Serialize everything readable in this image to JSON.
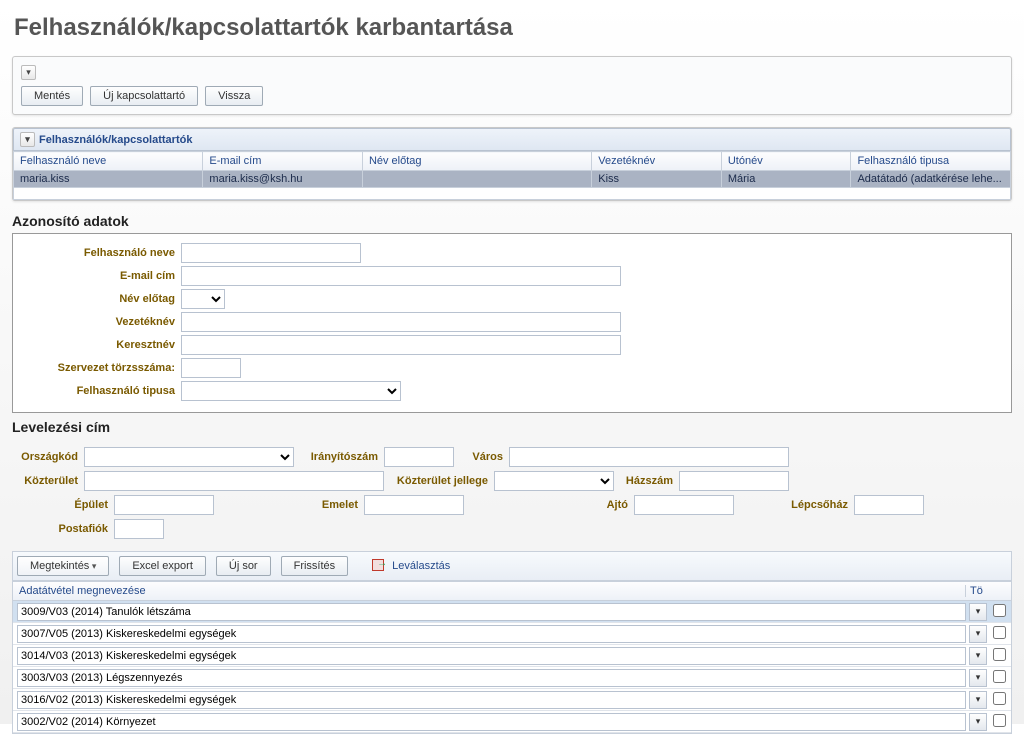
{
  "page_title": "Felhasználók/kapcsolattartók karbantartása",
  "top_panel": {
    "save_label": "Mentés",
    "new_contact_label": "Új kapcsolattartó",
    "back_label": "Vissza"
  },
  "users_panel": {
    "header": "Felhasználók/kapcsolattartók",
    "columns": {
      "username": "Felhasználó neve",
      "email": "E-mail cím",
      "prefix": "Név előtag",
      "lastname": "Vezetéknév",
      "firstname": "Utónév",
      "type": "Felhasználó tipusa"
    },
    "row": {
      "username": "maria.kiss",
      "email": "maria.kiss@ksh.hu",
      "prefix": "",
      "lastname": "Kiss",
      "firstname": "Mária",
      "type": "Adatátadó (adatkérése lehe..."
    }
  },
  "id_section": {
    "title": "Azonosító adatok",
    "labels": {
      "username": "Felhasználó neve",
      "email": "E-mail cím",
      "prefix": "Név előtag",
      "lastname": "Vezetéknév",
      "firstname": "Keresztnév",
      "orgid": "Szervezet törzsszáma:",
      "type": "Felhasználó tipusa"
    }
  },
  "mail_section": {
    "title": "Levelezési cím",
    "labels": {
      "country": "Országkód",
      "zip": "Irányítószám",
      "city": "Város",
      "street": "Közterület",
      "street_type": "Közterület jellege",
      "house_no": "Házszám",
      "building": "Épület",
      "floor": "Emelet",
      "door": "Ajtó",
      "stair": "Lépcsőház",
      "pobox": "Postafiók"
    }
  },
  "toolbar2": {
    "view": "Megtekintés",
    "excel": "Excel export",
    "newrow": "Új sor",
    "refresh": "Frissítés",
    "detach": "Leválasztás"
  },
  "list": {
    "col1": "Adatátvétel megnevezése",
    "col2": "Tö",
    "rows": [
      "3009/V03 (2014) Tanulók létszáma",
      "3007/V05 (2013) Kiskereskedelmi egységek",
      "3014/V03 (2013) Kiskereskedelmi egységek",
      "3003/V03 (2013) Légszennyezés",
      "3016/V02 (2013) Kiskereskedelmi egységek",
      "3002/V02 (2014) Környezet"
    ]
  }
}
